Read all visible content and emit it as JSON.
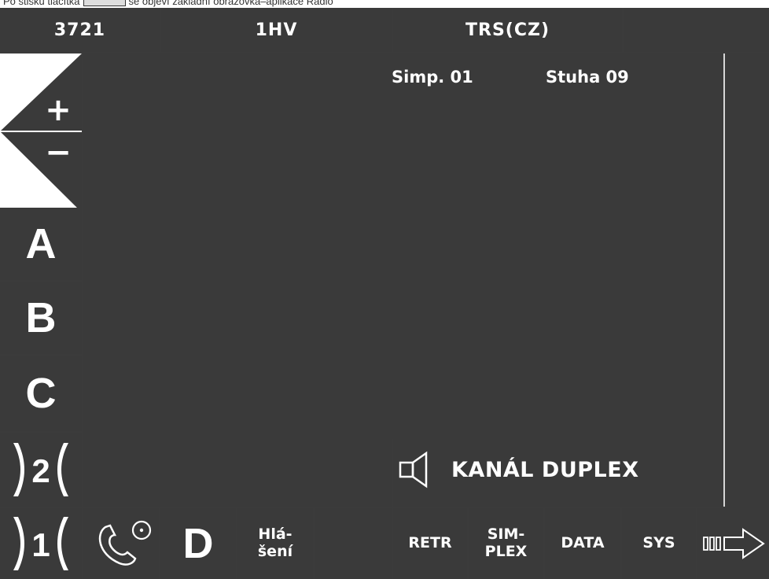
{
  "caption": {
    "before": "Po stisku tlačítka",
    "after": "se objeví základní obrazovka–aplikace Rádio"
  },
  "top_bar": {
    "train_number": "3721",
    "vehicle": "1HV",
    "system": "TRS(CZ)",
    "extra": ""
  },
  "status": {
    "simplex_channel": "Simp. 01",
    "ribbon": "Stuha 09"
  },
  "zoom": {
    "plus": "+",
    "minus": "−"
  },
  "side_buttons": {
    "a": "A",
    "b": "B",
    "c": "C"
  },
  "channel_mode": "KANÁL DUPLEX",
  "bottom_bar": {
    "d_label": "D",
    "report": {
      "line1": "Hlá-",
      "line2": "šení"
    },
    "retr": "RETR",
    "simplex": {
      "line1": "SIM-",
      "line2": "PLEX"
    },
    "data": "DATA",
    "sys": "SYS"
  },
  "colors": {
    "screen_bg": "#3a3a3a",
    "divider": "#d6d6d6",
    "text": "#ffffff"
  },
  "icons": [
    "zoom-triangle-icon",
    "radio-2-icon",
    "radio-1-icon",
    "phone-call-icon",
    "speaker-icon",
    "next-arrow-icon"
  ]
}
